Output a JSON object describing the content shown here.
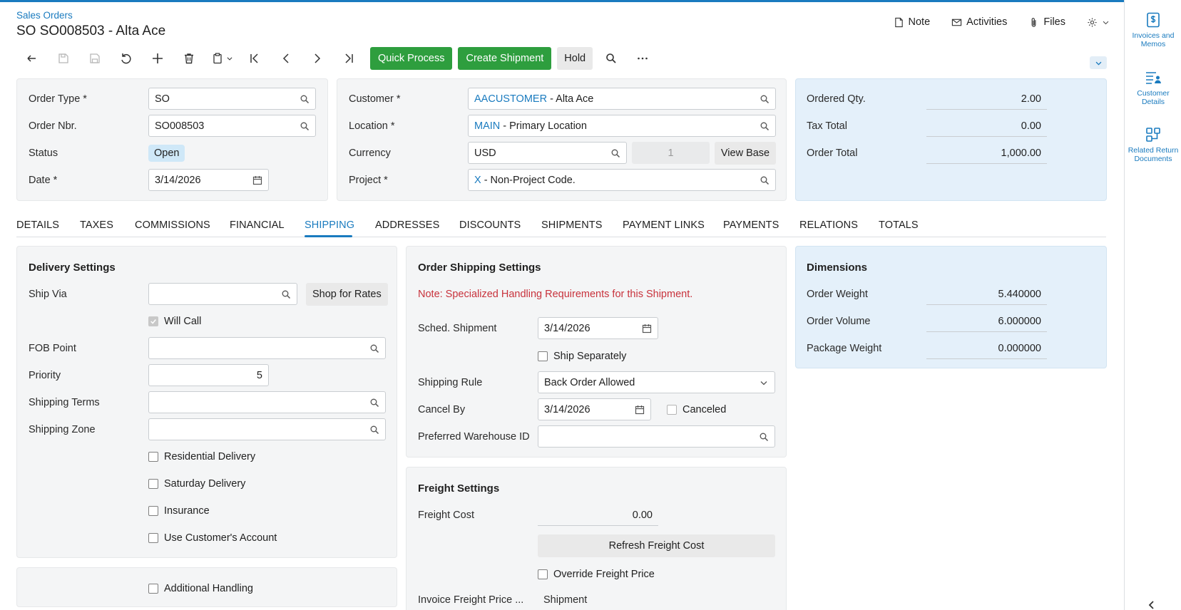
{
  "breadcrumb": "Sales Orders",
  "title": "SO SO008503 - Alta Ace",
  "header_actions": {
    "note": "Note",
    "activities": "Activities",
    "files": "Files"
  },
  "toolbar": {
    "quick_process": "Quick Process",
    "create_shipment": "Create Shipment",
    "hold": "Hold"
  },
  "summary": {
    "order_type_label": "Order Type *",
    "order_type": "SO",
    "order_nbr_label": "Order Nbr.",
    "order_nbr": "SO008503",
    "status_label": "Status",
    "status": "Open",
    "date_label": "Date *",
    "date": "3/14/2026",
    "customer_label": "Customer *",
    "customer_code": "AACUSTOMER",
    "customer_name": " - Alta Ace",
    "location_label": "Location *",
    "location_code": "MAIN",
    "location_name": " - Primary Location",
    "currency_label": "Currency",
    "currency": "USD",
    "currency_rate": "1",
    "view_base": "View Base",
    "project_label": "Project *",
    "project_code": "X",
    "project_name": " - Non-Project Code."
  },
  "totals": {
    "ordered_qty_label": "Ordered Qty.",
    "ordered_qty": "2.00",
    "tax_total_label": "Tax Total",
    "tax_total": "0.00",
    "order_total_label": "Order Total",
    "order_total": "1,000.00"
  },
  "tabs": [
    "DETAILS",
    "TAXES",
    "COMMISSIONS",
    "FINANCIAL",
    "SHIPPING",
    "ADDRESSES",
    "DISCOUNTS",
    "SHIPMENTS",
    "PAYMENT LINKS",
    "PAYMENTS",
    "RELATIONS",
    "TOTALS"
  ],
  "active_tab": "SHIPPING",
  "delivery": {
    "title": "Delivery Settings",
    "ship_via_label": "Ship Via",
    "ship_via": "",
    "shop_for_rates": "Shop for Rates",
    "will_call": "Will Call",
    "fob_point_label": "FOB Point",
    "fob_point": "",
    "priority_label": "Priority",
    "priority": "5",
    "shipping_terms_label": "Shipping Terms",
    "shipping_terms": "",
    "shipping_zone_label": "Shipping Zone",
    "shipping_zone": "",
    "residential_delivery": "Residential Delivery",
    "saturday_delivery": "Saturday Delivery",
    "insurance": "Insurance",
    "use_customers_account": "Use Customer's Account",
    "additional_handling": "Additional Handling"
  },
  "order_shipping": {
    "title": "Order Shipping Settings",
    "note": "Note: Specialized Handling Requirements for this Shipment.",
    "sched_shipment_label": "Sched. Shipment",
    "sched_shipment": "3/14/2026",
    "ship_separately": "Ship Separately",
    "shipping_rule_label": "Shipping Rule",
    "shipping_rule": "Back Order Allowed",
    "cancel_by_label": "Cancel By",
    "cancel_by": "3/14/2026",
    "canceled": "Canceled",
    "preferred_warehouse_label": "Preferred Warehouse ID",
    "preferred_warehouse": ""
  },
  "freight": {
    "title": "Freight Settings",
    "freight_cost_label": "Freight Cost",
    "freight_cost": "0.00",
    "refresh_freight_cost": "Refresh Freight Cost",
    "override_freight_price": "Override Freight Price",
    "invoice_freight_price_label": "Invoice Freight Price ...",
    "invoice_freight_price": "Shipment"
  },
  "dimensions": {
    "title": "Dimensions",
    "order_weight_label": "Order Weight",
    "order_weight": "5.440000",
    "order_volume_label": "Order Volume",
    "order_volume": "6.000000",
    "package_weight_label": "Package Weight",
    "package_weight": "0.000000"
  },
  "right_rail": {
    "invoices_memos": "Invoices and Memos",
    "customer_details": "Customer Details",
    "related_return_docs": "Related Return Documents"
  },
  "colors": {
    "accent": "#1a7bbf",
    "green": "#2e9e3e",
    "warning": "#c8323c",
    "blue_panel": "#e4f0fa"
  }
}
